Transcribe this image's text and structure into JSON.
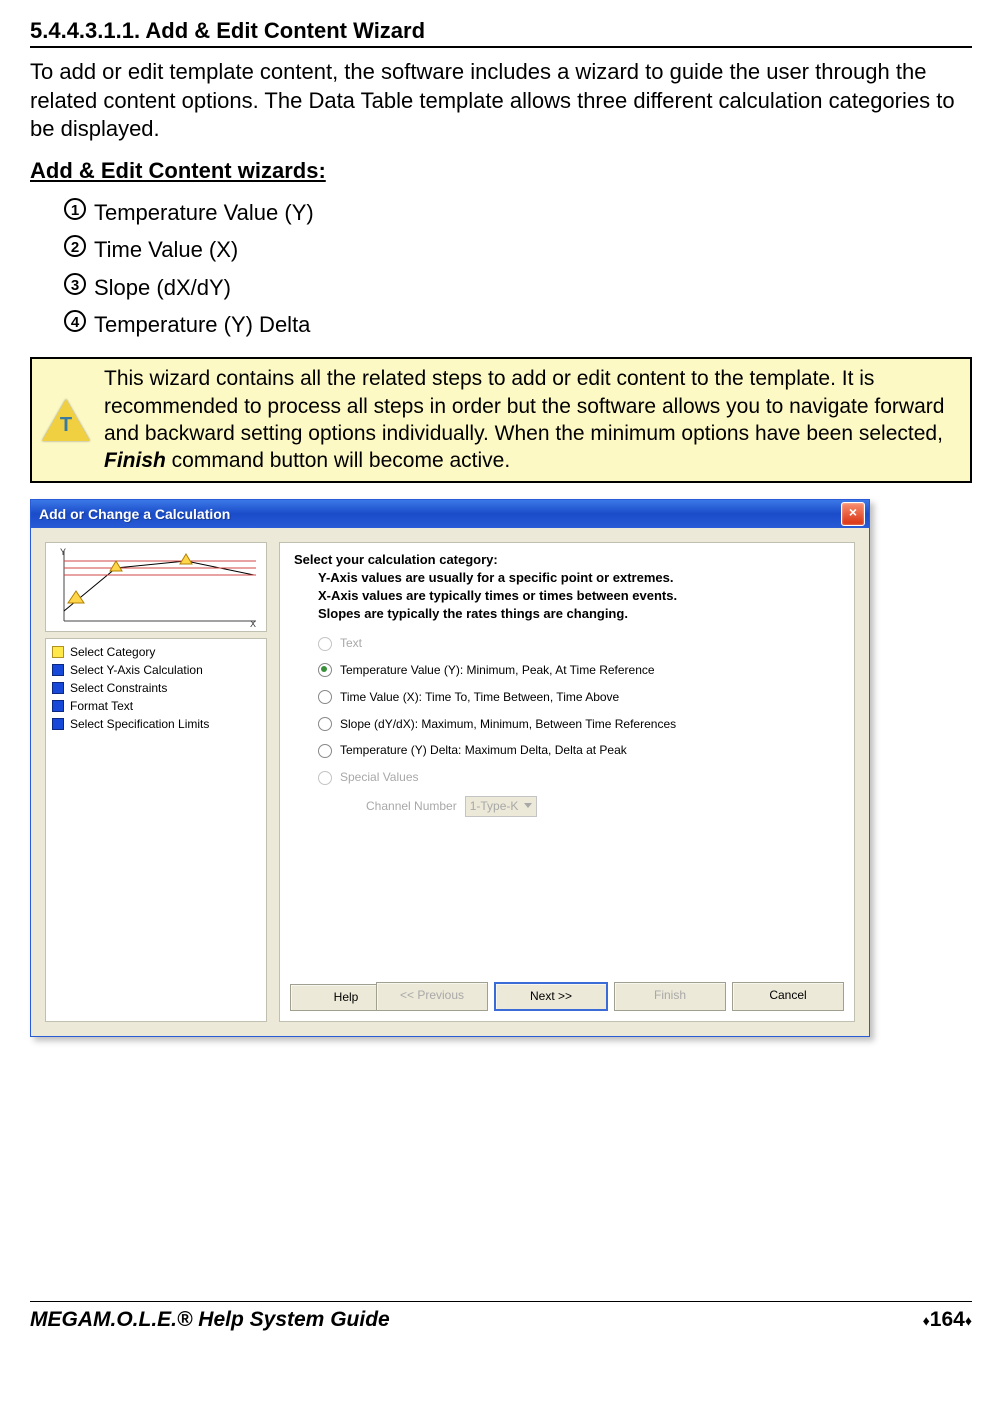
{
  "section": {
    "heading": "5.4.4.3.1.1. Add & Edit Content Wizard",
    "intro": "To add or edit template content, the software includes a wizard to guide the user through the related content options. The Data Table template allows three different calculation categories to be displayed.",
    "sub_heading": "Add & Edit Content wizards:",
    "list": [
      "Temperature Value (Y)",
      "Time Value (X)",
      "Slope (dX/dY)",
      "Temperature (Y) Delta"
    ],
    "tip": {
      "text_before": "This wizard contains all the related steps to add or edit content to the template. It is recommended to process all steps in order but the software allows you to navigate forward and backward setting options individually. When the minimum options have been selected, ",
      "finish_word": "Finish",
      "text_after": " command button will become active."
    }
  },
  "dialog": {
    "title": "Add or Change a Calculation",
    "close_glyph": "×",
    "steps": [
      "Select Category",
      "Select Y-Axis Calculation",
      "Select Constraints",
      "Format Text",
      "Select Specification Limits"
    ],
    "prompt": {
      "head": "Select your calculation category:",
      "line2": "Y-Axis values are usually for a specific point or extremes.",
      "line3": "X-Axis values are typically times or times between events.",
      "line4": "Slopes are typically the rates things are changing."
    },
    "options": {
      "text": "Text",
      "temp_y": "Temperature Value (Y):  Minimum, Peak, At Time Reference",
      "time_x": "Time Value (X):  Time To, Time Between, Time Above",
      "slope": "Slope (dY/dX):  Maximum, Minimum, Between Time References",
      "temp_delta": "Temperature (Y) Delta:  Maximum Delta, Delta at Peak",
      "special": "Special  Values",
      "channel_label": "Channel Number",
      "channel_value": "1-Type-K"
    },
    "buttons": {
      "help": "Help",
      "prev": "<< Previous",
      "next": "Next >>",
      "finish": "Finish",
      "cancel": "Cancel"
    }
  },
  "footer": {
    "left_prefix": "MEGA",
    "left_rest": "M.O.L.E.® Help System Guide",
    "page_number": "164"
  }
}
